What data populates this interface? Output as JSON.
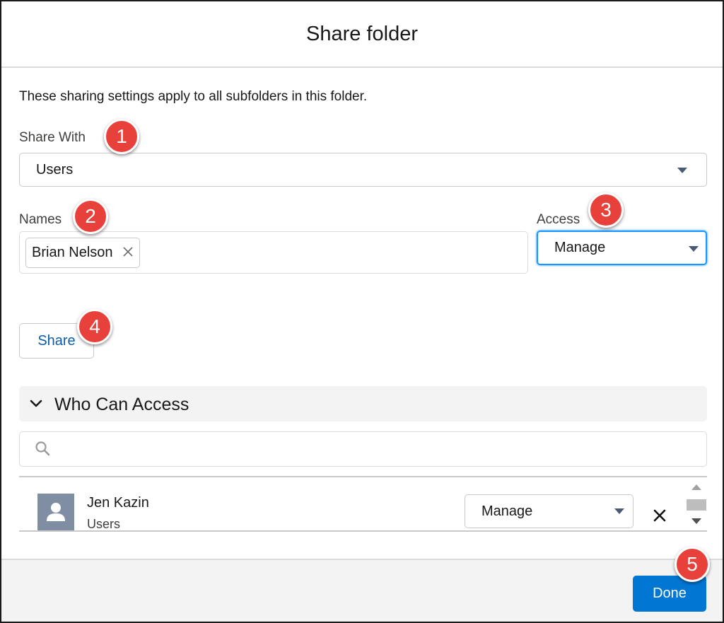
{
  "dialog": {
    "title": "Share folder",
    "description": "These sharing settings apply to all subfolders in this folder."
  },
  "share_with": {
    "label": "Share With",
    "selected": "Users"
  },
  "names": {
    "label": "Names",
    "pills": [
      "Brian Nelson"
    ]
  },
  "access": {
    "label": "Access",
    "selected": "Manage"
  },
  "share_button": {
    "label": "Share"
  },
  "who_can_access": {
    "title": "Who Can Access",
    "search_placeholder": "",
    "rows": [
      {
        "name": "Jen Kazin",
        "type": "Users",
        "access": "Manage"
      }
    ]
  },
  "footer": {
    "done_label": "Done"
  },
  "callouts": [
    "1",
    "2",
    "3",
    "4",
    "5"
  ],
  "colors": {
    "brand_blue": "#0176d3",
    "link_blue": "#0b5cab",
    "focus_blue": "#1b96ff",
    "callout_red": "#e8403a",
    "avatar_gray": "#7f8ea3"
  },
  "icons": [
    "caret-down-icon",
    "close-icon",
    "chevron-down-icon",
    "search-icon",
    "user-icon",
    "scroll-up-icon",
    "scroll-down-icon"
  ]
}
